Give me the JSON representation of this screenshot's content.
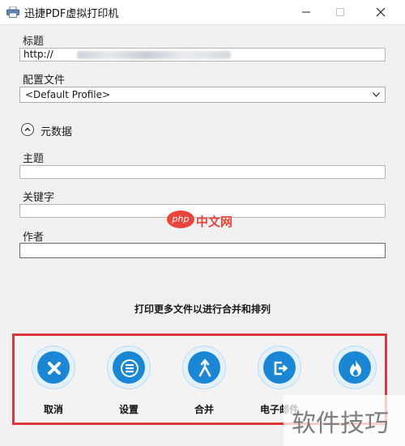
{
  "window": {
    "title": "迅捷PDF虚拟打印机"
  },
  "form": {
    "title_label": "标题",
    "title_value": "http://",
    "profile_label": "配置文件",
    "profile_selected": "<Default Profile>",
    "metadata_label": "元数据",
    "subject_label": "主题",
    "subject_value": "",
    "keywords_label": "关键字",
    "keywords_value": "",
    "author_label": "作者",
    "author_value": ""
  },
  "hint": "打印更多文件以进行合并和排列",
  "actions": [
    {
      "label": "取消",
      "icon": "cancel-x-icon"
    },
    {
      "label": "设置",
      "icon": "settings-menu-icon"
    },
    {
      "label": "合并",
      "icon": "merge-icon"
    },
    {
      "label": "电子邮件",
      "icon": "email-export-icon"
    },
    {
      "label": "",
      "icon": "flame-icon"
    }
  ],
  "watermarks": {
    "php_badge": "php",
    "php_site": "中文网",
    "tips": "软件技巧"
  },
  "colors": {
    "accent_blue": "#1b86d3",
    "highlight_red": "#d9363e"
  }
}
